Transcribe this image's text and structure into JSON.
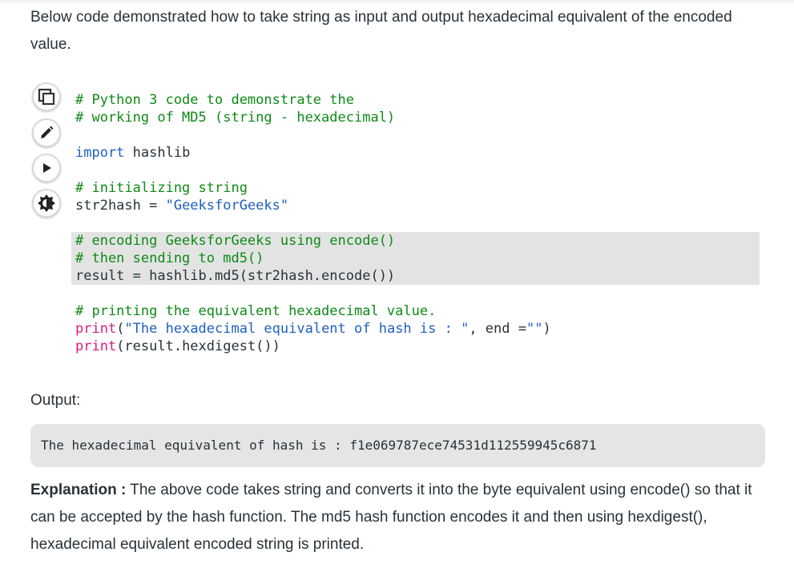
{
  "intro": "Below code demonstrated how to take string as input and output hexadecimal equivalent of the encoded value.",
  "toolbar": {
    "icons": [
      "copy-icon",
      "edit-icon",
      "run-icon",
      "theme-icon"
    ]
  },
  "code": {
    "lines": [
      [
        {
          "c": "cm",
          "t": "# Python 3 code to demonstrate the"
        }
      ],
      [
        {
          "c": "cm",
          "t": "# working of MD5 (string - hexadecimal)"
        }
      ],
      [],
      [
        {
          "c": "kw",
          "t": "import"
        },
        {
          "c": "tx",
          "t": " hashlib"
        }
      ],
      [],
      [
        {
          "c": "cm",
          "t": "# initializing string"
        }
      ],
      [
        {
          "c": "tx",
          "t": "str2hash = "
        },
        {
          "c": "st",
          "t": "\"GeeksforGeeks\""
        }
      ],
      [],
      [
        {
          "c": "cm",
          "t": "# encoding GeeksforGeeks using encode()"
        }
      ],
      [
        {
          "c": "cm",
          "t": "# then sending to md5()"
        }
      ],
      [
        {
          "c": "tx",
          "t": "result = hashlib.md5(str2hash.encode())"
        }
      ],
      [],
      [
        {
          "c": "cm",
          "t": "# printing the equivalent hexadecimal value."
        }
      ],
      [
        {
          "c": "fn",
          "t": "print"
        },
        {
          "c": "tx",
          "t": "("
        },
        {
          "c": "st",
          "t": "\"The hexadecimal equivalent of hash is : \""
        },
        {
          "c": "tx",
          "t": ", end ="
        },
        {
          "c": "st",
          "t": "\"\""
        },
        {
          "c": "tx",
          "t": ")"
        }
      ],
      [
        {
          "c": "fn",
          "t": "print"
        },
        {
          "c": "tx",
          "t": "(result.hexdigest())"
        }
      ]
    ]
  },
  "output_label": "Output:",
  "output_text": "The hexadecimal equivalent of hash is : f1e069787ece74531d112559945c6871",
  "explanation": {
    "label": "Explanation :",
    "text": " The above code takes string and converts it into the byte equivalent using encode() so that it can be accepted by the hash function. The md5 hash function encodes it and then using hexdigest(), hexadecimal equivalent encoded string is printed."
  }
}
